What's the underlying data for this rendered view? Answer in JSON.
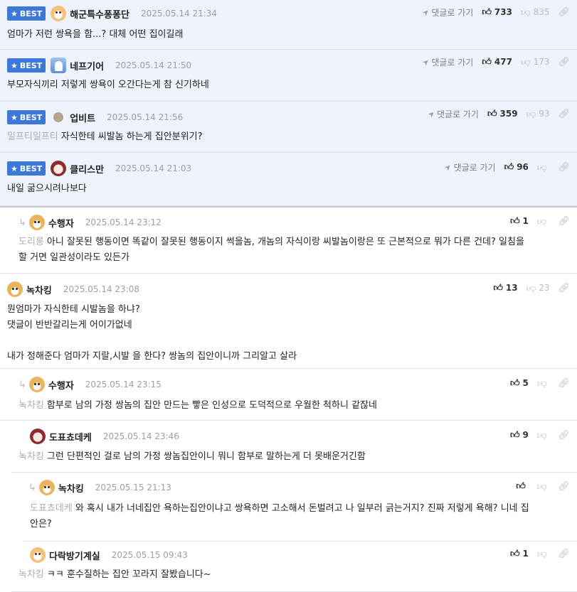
{
  "best_badge_label": "BEST",
  "goto_label": "댓글로 가기",
  "comments": [
    {
      "nick": "해군특수퐁퐁단",
      "date": "2025.05.14 21:34",
      "up": "733",
      "down": "835",
      "lines": [
        "엄마가 저런 쌍욕을 함...? 대체 어떤 집이길래"
      ]
    },
    {
      "nick": "네프기어",
      "date": "2025.05.14 21:50",
      "up": "477",
      "down": "173",
      "lines": [
        "부모자식끼리 저렇게 쌍욕이 오간다는게 참 신기하네"
      ]
    },
    {
      "nick": "업비트",
      "date": "2025.05.14 21:56",
      "up": "359",
      "down": "93",
      "mention": "밀프티밀프티",
      "lines": [
        "자식한테 씨발놈 하는게 집안분위기?"
      ]
    },
    {
      "nick": "클리스만",
      "date": "2025.05.14 21:03",
      "up": "96",
      "down": "",
      "lines": [
        "내일 굶으시려나보다"
      ]
    },
    {
      "nick": "수행자",
      "date": "2025.05.14 23:12",
      "up": "1",
      "down": "",
      "mention": "도리롱",
      "lines": [
        "아니 잘못된 행동이면 똑같이 잘못된 행동이지 썩을놈, 개놈의 자식이랑 씨발놈이랑은 또 근본적으로 뭐가 다른 건데? 일침을",
        "할 거면 일관성이라도 있든가"
      ]
    },
    {
      "nick": "녹차킹",
      "date": "2025.05.14 23:08",
      "up": "13",
      "down": "23",
      "lines": [
        "뭔엄마가 자식한테 시발놈을 하냐?",
        "댓글이 반반갈리는게 어이가없네",
        "",
        "내가 정해준다 엄마가 지랄,시발 을 한다? 쌍놈의 집안이니까 그리알고 살라"
      ]
    },
    {
      "nick": "수행자",
      "date": "2025.05.14 23:15",
      "up": "5",
      "down": "",
      "mention": "녹차킹",
      "lines": [
        "함부로 남의 가정 쌍놈의 집안 만드는 빻은 인성으로 도덕적으로 우월한 척하니 같잖네"
      ]
    },
    {
      "nick": "도표쵸데케",
      "date": "2025.05.14 23:46",
      "up": "9",
      "down": "",
      "mention": "녹차킹",
      "lines": [
        "그런 단편적인 걸로 남의 가정 쌍놈집안이니 뭐니 함부로 말하는게 더 못배운거긴함"
      ]
    },
    {
      "nick": "녹차킹",
      "date": "2025.05.15 21:13",
      "up": "",
      "down": "",
      "mention": "도표쵸데케",
      "lines": [
        "와 혹시 내가 너네집안 욕하는집안이냐고 쌍욕하면 고소해서 돈벌려고 나 일부러 긁는거지? 진짜 저렇게 욕해? 니네 집",
        "안은?"
      ]
    },
    {
      "nick": "다락방기계실",
      "date": "2025.05.15 09:43",
      "up": "1",
      "down": "",
      "mention": "녹차킹",
      "lines": [
        "ㅋㅋ 훈수질하는 집안 꼬라지 잘봤습니다~"
      ]
    }
  ]
}
